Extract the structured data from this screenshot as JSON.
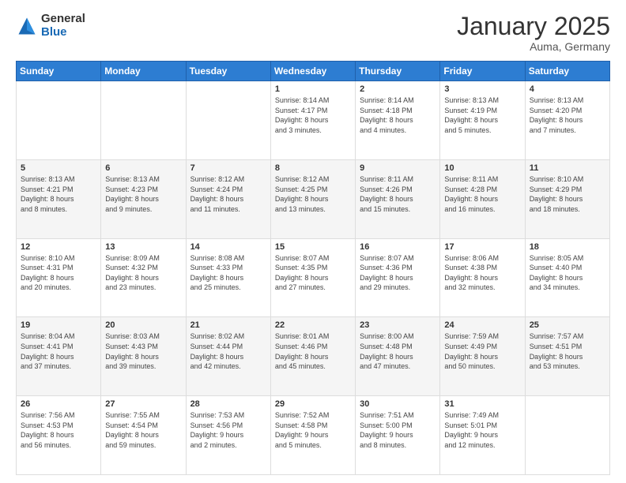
{
  "logo": {
    "general": "General",
    "blue": "Blue"
  },
  "header": {
    "title": "January 2025",
    "subtitle": "Auma, Germany"
  },
  "weekdays": [
    "Sunday",
    "Monday",
    "Tuesday",
    "Wednesday",
    "Thursday",
    "Friday",
    "Saturday"
  ],
  "weeks": [
    [
      {
        "day": "",
        "info": ""
      },
      {
        "day": "",
        "info": ""
      },
      {
        "day": "",
        "info": ""
      },
      {
        "day": "1",
        "info": "Sunrise: 8:14 AM\nSunset: 4:17 PM\nDaylight: 8 hours\nand 3 minutes."
      },
      {
        "day": "2",
        "info": "Sunrise: 8:14 AM\nSunset: 4:18 PM\nDaylight: 8 hours\nand 4 minutes."
      },
      {
        "day": "3",
        "info": "Sunrise: 8:13 AM\nSunset: 4:19 PM\nDaylight: 8 hours\nand 5 minutes."
      },
      {
        "day": "4",
        "info": "Sunrise: 8:13 AM\nSunset: 4:20 PM\nDaylight: 8 hours\nand 7 minutes."
      }
    ],
    [
      {
        "day": "5",
        "info": "Sunrise: 8:13 AM\nSunset: 4:21 PM\nDaylight: 8 hours\nand 8 minutes."
      },
      {
        "day": "6",
        "info": "Sunrise: 8:13 AM\nSunset: 4:23 PM\nDaylight: 8 hours\nand 9 minutes."
      },
      {
        "day": "7",
        "info": "Sunrise: 8:12 AM\nSunset: 4:24 PM\nDaylight: 8 hours\nand 11 minutes."
      },
      {
        "day": "8",
        "info": "Sunrise: 8:12 AM\nSunset: 4:25 PM\nDaylight: 8 hours\nand 13 minutes."
      },
      {
        "day": "9",
        "info": "Sunrise: 8:11 AM\nSunset: 4:26 PM\nDaylight: 8 hours\nand 15 minutes."
      },
      {
        "day": "10",
        "info": "Sunrise: 8:11 AM\nSunset: 4:28 PM\nDaylight: 8 hours\nand 16 minutes."
      },
      {
        "day": "11",
        "info": "Sunrise: 8:10 AM\nSunset: 4:29 PM\nDaylight: 8 hours\nand 18 minutes."
      }
    ],
    [
      {
        "day": "12",
        "info": "Sunrise: 8:10 AM\nSunset: 4:31 PM\nDaylight: 8 hours\nand 20 minutes."
      },
      {
        "day": "13",
        "info": "Sunrise: 8:09 AM\nSunset: 4:32 PM\nDaylight: 8 hours\nand 23 minutes."
      },
      {
        "day": "14",
        "info": "Sunrise: 8:08 AM\nSunset: 4:33 PM\nDaylight: 8 hours\nand 25 minutes."
      },
      {
        "day": "15",
        "info": "Sunrise: 8:07 AM\nSunset: 4:35 PM\nDaylight: 8 hours\nand 27 minutes."
      },
      {
        "day": "16",
        "info": "Sunrise: 8:07 AM\nSunset: 4:36 PM\nDaylight: 8 hours\nand 29 minutes."
      },
      {
        "day": "17",
        "info": "Sunrise: 8:06 AM\nSunset: 4:38 PM\nDaylight: 8 hours\nand 32 minutes."
      },
      {
        "day": "18",
        "info": "Sunrise: 8:05 AM\nSunset: 4:40 PM\nDaylight: 8 hours\nand 34 minutes."
      }
    ],
    [
      {
        "day": "19",
        "info": "Sunrise: 8:04 AM\nSunset: 4:41 PM\nDaylight: 8 hours\nand 37 minutes."
      },
      {
        "day": "20",
        "info": "Sunrise: 8:03 AM\nSunset: 4:43 PM\nDaylight: 8 hours\nand 39 minutes."
      },
      {
        "day": "21",
        "info": "Sunrise: 8:02 AM\nSunset: 4:44 PM\nDaylight: 8 hours\nand 42 minutes."
      },
      {
        "day": "22",
        "info": "Sunrise: 8:01 AM\nSunset: 4:46 PM\nDaylight: 8 hours\nand 45 minutes."
      },
      {
        "day": "23",
        "info": "Sunrise: 8:00 AM\nSunset: 4:48 PM\nDaylight: 8 hours\nand 47 minutes."
      },
      {
        "day": "24",
        "info": "Sunrise: 7:59 AM\nSunset: 4:49 PM\nDaylight: 8 hours\nand 50 minutes."
      },
      {
        "day": "25",
        "info": "Sunrise: 7:57 AM\nSunset: 4:51 PM\nDaylight: 8 hours\nand 53 minutes."
      }
    ],
    [
      {
        "day": "26",
        "info": "Sunrise: 7:56 AM\nSunset: 4:53 PM\nDaylight: 8 hours\nand 56 minutes."
      },
      {
        "day": "27",
        "info": "Sunrise: 7:55 AM\nSunset: 4:54 PM\nDaylight: 8 hours\nand 59 minutes."
      },
      {
        "day": "28",
        "info": "Sunrise: 7:53 AM\nSunset: 4:56 PM\nDaylight: 9 hours\nand 2 minutes."
      },
      {
        "day": "29",
        "info": "Sunrise: 7:52 AM\nSunset: 4:58 PM\nDaylight: 9 hours\nand 5 minutes."
      },
      {
        "day": "30",
        "info": "Sunrise: 7:51 AM\nSunset: 5:00 PM\nDaylight: 9 hours\nand 8 minutes."
      },
      {
        "day": "31",
        "info": "Sunrise: 7:49 AM\nSunset: 5:01 PM\nDaylight: 9 hours\nand 12 minutes."
      },
      {
        "day": "",
        "info": ""
      }
    ]
  ]
}
